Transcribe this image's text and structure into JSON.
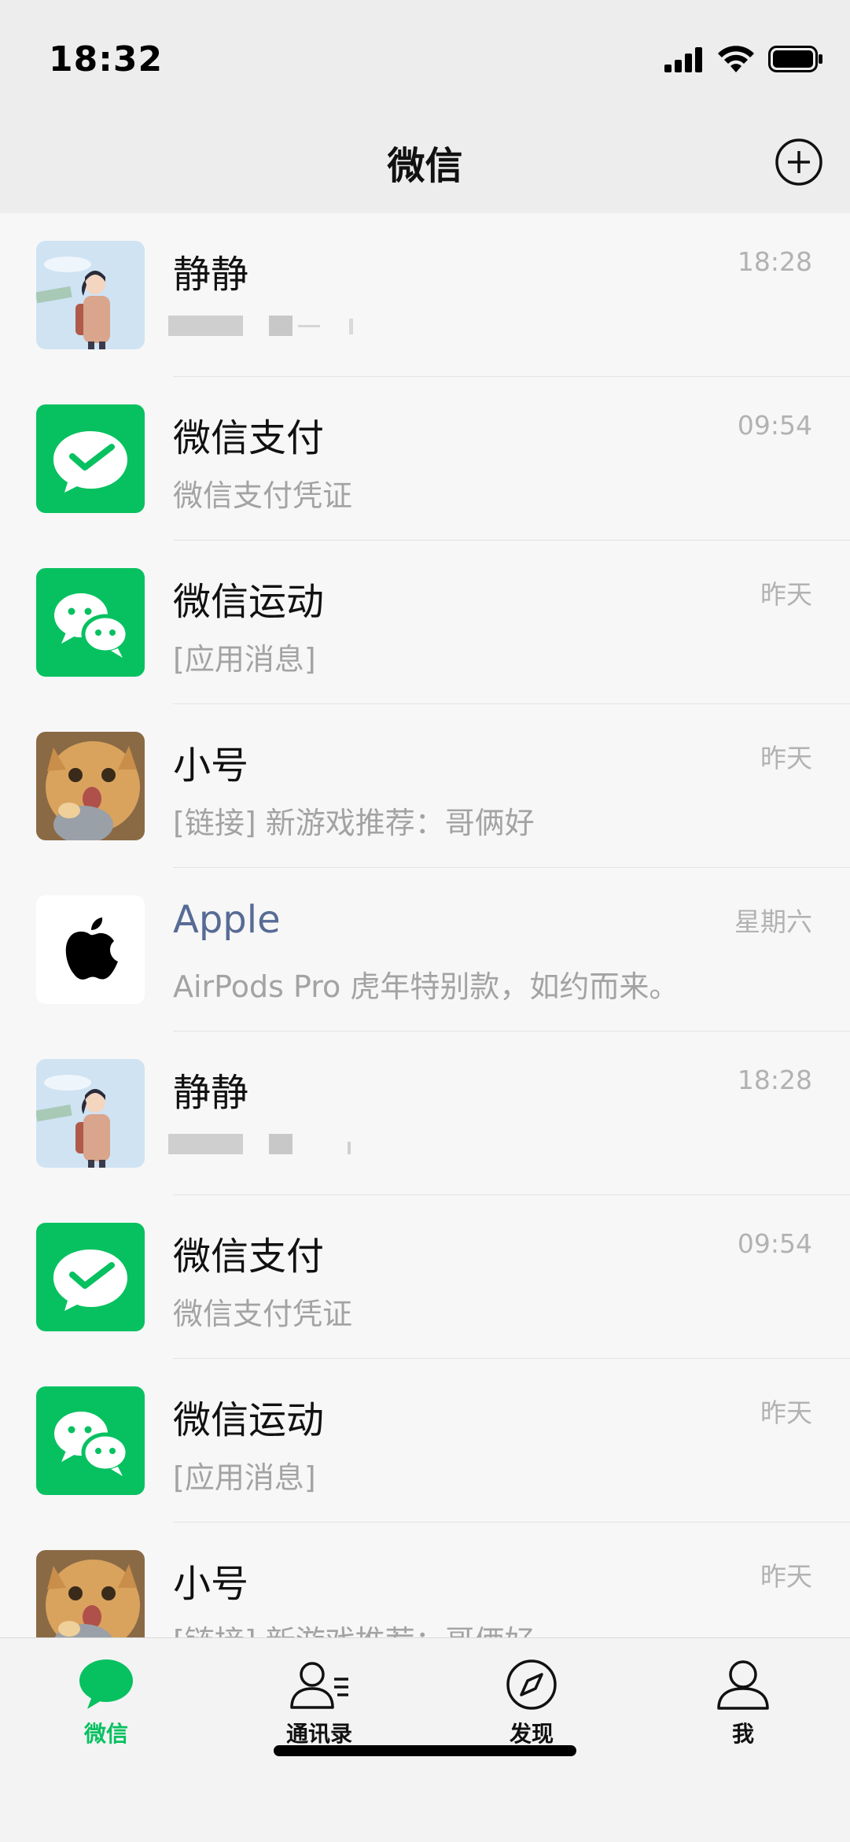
{
  "status_bar": {
    "time": "18:32",
    "icons": [
      "signal-icon",
      "wifi-icon",
      "battery-icon"
    ]
  },
  "nav": {
    "title": "微信",
    "add_icon": "plus-circle-icon"
  },
  "colors": {
    "accent": "#07c160",
    "official_name": "#576b95",
    "muted_text": "#a3a3a3",
    "background": "#f7f7f7"
  },
  "chats": [
    {
      "name": "静静",
      "time": "18:28",
      "preview": "",
      "avatar": "anime-girl-avatar"
    },
    {
      "name": "微信支付",
      "time": "09:54",
      "preview": "微信支付凭证",
      "avatar": "wechat-pay-icon"
    },
    {
      "name": "微信运动",
      "time": "昨天",
      "preview": "[应用消息]",
      "avatar": "wechat-sport-icon"
    },
    {
      "name": "小号",
      "time": "昨天",
      "preview": "[链接] 新游戏推荐：哥俩好",
      "avatar": "cat-avatar"
    },
    {
      "name": "Apple",
      "time": "星期六",
      "preview": "AirPods Pro 虎年特别款，如约而来。",
      "avatar": "apple-logo-icon"
    },
    {
      "name": "静静",
      "time": "18:28",
      "preview": "",
      "avatar": "anime-girl-avatar"
    },
    {
      "name": "微信支付",
      "time": "09:54",
      "preview": "微信支付凭证",
      "avatar": "wechat-pay-icon"
    },
    {
      "name": "微信运动",
      "time": "昨天",
      "preview": "[应用消息]",
      "avatar": "wechat-sport-icon"
    },
    {
      "name": "小号",
      "time": "昨天",
      "preview": "[链接] 新游戏推荐：哥俩好",
      "avatar": "cat-avatar"
    }
  ],
  "tabs": [
    {
      "label": "微信",
      "icon": "chat-bubble-icon",
      "active": true
    },
    {
      "label": "通讯录",
      "icon": "contacts-icon",
      "active": false
    },
    {
      "label": "发现",
      "icon": "compass-icon",
      "active": false
    },
    {
      "label": "我",
      "icon": "person-icon",
      "active": false
    }
  ]
}
